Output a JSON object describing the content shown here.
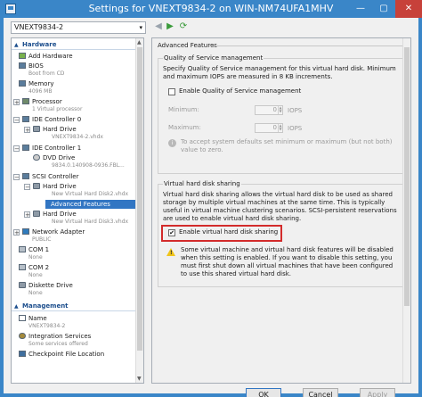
{
  "window": {
    "title": "Settings for VNEXT9834-2 on WIN-NM74UFA1MHV"
  },
  "vm_selector": {
    "value": "VNEXT9834-2"
  },
  "tree": {
    "hardware_header": "Hardware",
    "management_header": "Management",
    "items": [
      {
        "label": "Add Hardware"
      },
      {
        "label": "BIOS",
        "sub": "Boot from CD"
      },
      {
        "label": "Memory",
        "sub": "4096 MB"
      },
      {
        "label": "Processor",
        "sub": "1 Virtual processor"
      },
      {
        "label": "IDE Controller 0"
      },
      {
        "label": "Hard Drive",
        "sub": "VNEXT9834-2.vhdx"
      },
      {
        "label": "IDE Controller 1"
      },
      {
        "label": "DVD Drive",
        "sub": "9834.0.140908-0936.FBL..."
      },
      {
        "label": "SCSI Controller"
      },
      {
        "label": "Hard Drive",
        "sub": "New Virtual Hard Disk2.vhdx"
      },
      {
        "label": "Advanced Features"
      },
      {
        "label": "Hard Drive",
        "sub": "New Virtual Hard Disk3.vhdx"
      },
      {
        "label": "Network Adapter",
        "sub": "PUBLIC"
      },
      {
        "label": "COM 1",
        "sub": "None"
      },
      {
        "label": "COM 2",
        "sub": "None"
      },
      {
        "label": "Diskette Drive",
        "sub": "None"
      },
      {
        "label": "Name",
        "sub": "VNEXT9834-2"
      },
      {
        "label": "Integration Services",
        "sub": "Some services offered"
      },
      {
        "label": "Checkpoint File Location"
      }
    ]
  },
  "panel": {
    "header": "Advanced Features",
    "qos": {
      "title": "Quality of Service management",
      "description": "Specify Quality of Service management for this virtual hard disk. Minimum and maximum IOPS are measured in 8 KB increments.",
      "enable_label": "Enable Quality of Service management",
      "enabled": false,
      "minimum_label": "Minimum:",
      "minimum_value": "0",
      "maximum_label": "Maximum:",
      "maximum_value": "0",
      "unit": "IOPS",
      "info": "To accept system defaults set minimum or maximum (but not both) value to zero."
    },
    "sharing": {
      "title": "Virtual hard disk sharing",
      "description": "Virtual hard disk sharing allows the virtual hard disk to be used as shared storage by multiple virtual machines at the same time. This is typically useful in virtual machine clustering scenarios. SCSI-persistent reservations are used to enable virtual hard disk sharing.",
      "enable_label": "Enable virtual hard disk sharing",
      "enabled": true,
      "check_glyph": "✔",
      "warning": "Some virtual machine and virtual hard disk features will be disabled when this setting is enabled. If you want to disable this setting, you must first shut down all virtual machines that have been configured to use this shared virtual hard disk."
    }
  },
  "buttons": {
    "ok": "OK",
    "cancel": "Cancel",
    "apply": "Apply"
  },
  "icons": {
    "chevron": "▾",
    "back": "◀",
    "forward": "▶",
    "refresh": "⟳",
    "minimize": "—",
    "maximize": "▢",
    "close": "✕",
    "expand_minus": "−",
    "expand_plus": "+",
    "collapse": "▲",
    "scroll_up": "▲",
    "scroll_down": "▼",
    "info": "i",
    "warning": "!"
  },
  "colors": {
    "titlebar": "#3a86c8",
    "selection": "#3276c3",
    "highlight": "#d32b2b"
  }
}
